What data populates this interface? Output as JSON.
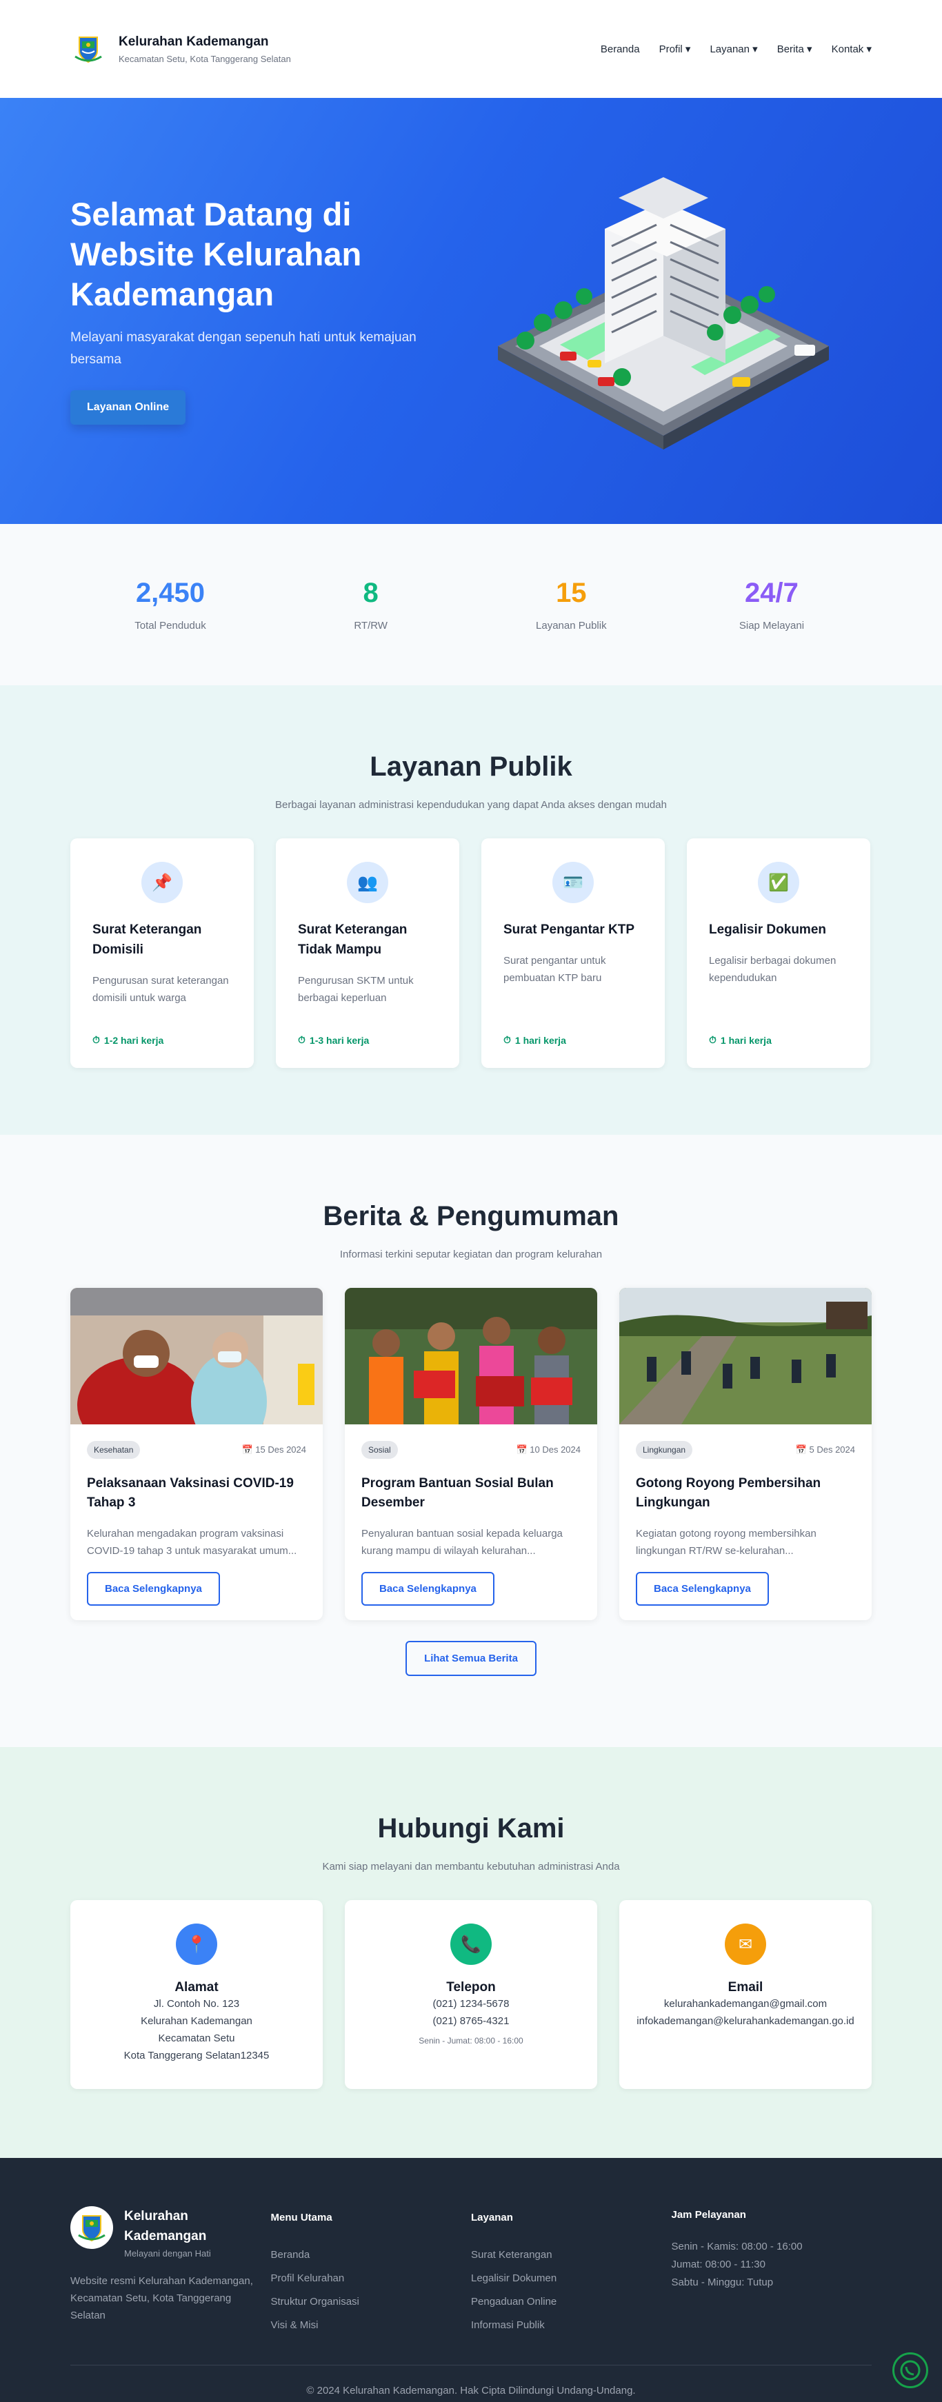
{
  "header": {
    "title": "Kelurahan Kademangan",
    "subtitle": "Kecamatan Setu, Kota Tanggerang Selatan",
    "nav": [
      "Beranda",
      "Profil ▾",
      "Layanan ▾",
      "Berita ▾",
      "Kontak ▾"
    ]
  },
  "hero": {
    "title": "Selamat Datang di Website Kelurahan Kademangan",
    "subtitle": "Melayani masyarakat dengan sepenuh hati untuk kemajuan bersama",
    "button": "Layanan Online"
  },
  "stats": [
    {
      "value": "2,450",
      "label": "Total Penduduk",
      "color": "#3b82f6"
    },
    {
      "value": "8",
      "label": "RT/RW",
      "color": "#10b981"
    },
    {
      "value": "15",
      "label": "Layanan Publik",
      "color": "#f59e0b"
    },
    {
      "value": "24/7",
      "label": "Siap Melayani",
      "color": "#8b5cf6"
    }
  ],
  "services": {
    "title": "Layanan Publik",
    "subtitle": "Berbagai layanan administrasi kependudukan yang dapat Anda akses dengan mudah",
    "items": [
      {
        "icon": "📌",
        "icon_name": "pin-icon",
        "title": "Surat Keterangan Domisili",
        "desc": "Pengurusan surat keterangan domisili untuk warga",
        "time": "1-2 hari kerja"
      },
      {
        "icon": "👥",
        "icon_name": "people-icon",
        "title": "Surat Keterangan Tidak Mampu",
        "desc": "Pengurusan SKTM untuk berbagai keperluan",
        "time": "1-3 hari kerja"
      },
      {
        "icon": "🪪",
        "icon_name": "id-card-icon",
        "title": "Surat Pengantar KTP",
        "desc": "Surat pengantar untuk pembuatan KTP baru",
        "time": "1 hari kerja"
      },
      {
        "icon": "✅",
        "icon_name": "check-icon",
        "title": "Legalisir Dokumen",
        "desc": "Legalisir berbagai dokumen kependudukan",
        "time": "1 hari kerja"
      }
    ]
  },
  "news": {
    "title": "Berita & Pengumuman",
    "subtitle": "Informasi terkini seputar kegiatan dan program kelurahan",
    "read_more": "Baca Selengkapnya",
    "all_button": "Lihat Semua Berita",
    "items": [
      {
        "tag": "Kesehatan",
        "date": "15 Des 2024",
        "title": "Pelaksanaan Vaksinasi COVID-19 Tahap 3",
        "desc": "Kelurahan mengadakan program vaksinasi COVID-19 tahap 3 untuk masyarakat umum..."
      },
      {
        "tag": "Sosial",
        "date": "10 Des 2024",
        "title": "Program Bantuan Sosial Bulan Desember",
        "desc": "Penyaluran bantuan sosial kepada keluarga kurang mampu di wilayah kelurahan..."
      },
      {
        "tag": "Lingkungan",
        "date": "5 Des 2024",
        "title": "Gotong Royong Pembersihan Lingkungan",
        "desc": "Kegiatan gotong royong membersihkan lingkungan RT/RW se-kelurahan..."
      }
    ]
  },
  "contact": {
    "title": "Hubungi Kami",
    "subtitle": "Kami siap melayani dan membantu kebutuhan administrasi Anda",
    "address": {
      "title": "Alamat",
      "lines": [
        "Jl. Contoh No. 123",
        "Kelurahan Kademangan",
        "Kecamatan Setu",
        "Kota Tanggerang Selatan12345"
      ],
      "color": "#3b82f6"
    },
    "phone": {
      "title": "Telepon",
      "lines": [
        "(021) 1234-5678",
        "(021) 8765-4321"
      ],
      "note": "Senin - Jumat: 08:00 - 16:00",
      "color": "#10b981"
    },
    "email": {
      "title": "Email",
      "lines": [
        "kelurahankademangan@gmail.com",
        "infokademangan@kelurahankademangan.go.id"
      ],
      "color": "#f59e0b"
    }
  },
  "footer": {
    "name": "Kelurahan Kademangan",
    "tagline": "Melayani dengan Hati",
    "desc": "Website resmi Kelurahan Kademangan, Kecamatan Setu, Kota Tanggerang Selatan",
    "menu_title": "Menu Utama",
    "menu": [
      "Beranda",
      "Profil Kelurahan",
      "Struktur Organisasi",
      "Visi & Misi"
    ],
    "services_title": "Layanan",
    "services": [
      "Surat Keterangan",
      "Legalisir Dokumen",
      "Pengaduan Online",
      "Informasi Publik"
    ],
    "hours_title": "Jam Pelayanan",
    "hours": [
      "Senin - Kamis: 08:00 - 16:00",
      "Jumat: 08:00 - 11:30",
      "Sabtu - Minggu: Tutup"
    ],
    "copyright": "© 2024 Kelurahan Kademangan. Hak Cipta Dilindungi Undang-Undang."
  }
}
